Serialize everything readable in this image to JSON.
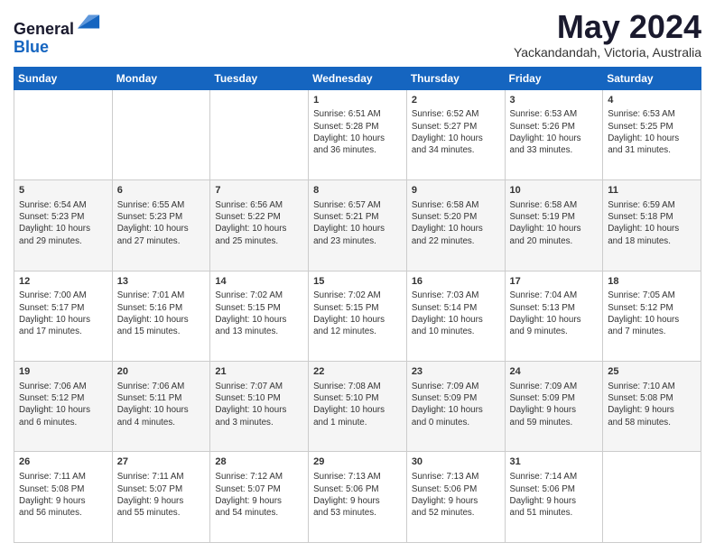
{
  "header": {
    "logo_line1": "General",
    "logo_line2": "Blue",
    "month": "May 2024",
    "location": "Yackandandah, Victoria, Australia"
  },
  "weekdays": [
    "Sunday",
    "Monday",
    "Tuesday",
    "Wednesday",
    "Thursday",
    "Friday",
    "Saturday"
  ],
  "weeks": [
    [
      {
        "day": "",
        "info": ""
      },
      {
        "day": "",
        "info": ""
      },
      {
        "day": "",
        "info": ""
      },
      {
        "day": "1",
        "info": "Sunrise: 6:51 AM\nSunset: 5:28 PM\nDaylight: 10 hours\nand 36 minutes."
      },
      {
        "day": "2",
        "info": "Sunrise: 6:52 AM\nSunset: 5:27 PM\nDaylight: 10 hours\nand 34 minutes."
      },
      {
        "day": "3",
        "info": "Sunrise: 6:53 AM\nSunset: 5:26 PM\nDaylight: 10 hours\nand 33 minutes."
      },
      {
        "day": "4",
        "info": "Sunrise: 6:53 AM\nSunset: 5:25 PM\nDaylight: 10 hours\nand 31 minutes."
      }
    ],
    [
      {
        "day": "5",
        "info": "Sunrise: 6:54 AM\nSunset: 5:23 PM\nDaylight: 10 hours\nand 29 minutes."
      },
      {
        "day": "6",
        "info": "Sunrise: 6:55 AM\nSunset: 5:23 PM\nDaylight: 10 hours\nand 27 minutes."
      },
      {
        "day": "7",
        "info": "Sunrise: 6:56 AM\nSunset: 5:22 PM\nDaylight: 10 hours\nand 25 minutes."
      },
      {
        "day": "8",
        "info": "Sunrise: 6:57 AM\nSunset: 5:21 PM\nDaylight: 10 hours\nand 23 minutes."
      },
      {
        "day": "9",
        "info": "Sunrise: 6:58 AM\nSunset: 5:20 PM\nDaylight: 10 hours\nand 22 minutes."
      },
      {
        "day": "10",
        "info": "Sunrise: 6:58 AM\nSunset: 5:19 PM\nDaylight: 10 hours\nand 20 minutes."
      },
      {
        "day": "11",
        "info": "Sunrise: 6:59 AM\nSunset: 5:18 PM\nDaylight: 10 hours\nand 18 minutes."
      }
    ],
    [
      {
        "day": "12",
        "info": "Sunrise: 7:00 AM\nSunset: 5:17 PM\nDaylight: 10 hours\nand 17 minutes."
      },
      {
        "day": "13",
        "info": "Sunrise: 7:01 AM\nSunset: 5:16 PM\nDaylight: 10 hours\nand 15 minutes."
      },
      {
        "day": "14",
        "info": "Sunrise: 7:02 AM\nSunset: 5:15 PM\nDaylight: 10 hours\nand 13 minutes."
      },
      {
        "day": "15",
        "info": "Sunrise: 7:02 AM\nSunset: 5:15 PM\nDaylight: 10 hours\nand 12 minutes."
      },
      {
        "day": "16",
        "info": "Sunrise: 7:03 AM\nSunset: 5:14 PM\nDaylight: 10 hours\nand 10 minutes."
      },
      {
        "day": "17",
        "info": "Sunrise: 7:04 AM\nSunset: 5:13 PM\nDaylight: 10 hours\nand 9 minutes."
      },
      {
        "day": "18",
        "info": "Sunrise: 7:05 AM\nSunset: 5:12 PM\nDaylight: 10 hours\nand 7 minutes."
      }
    ],
    [
      {
        "day": "19",
        "info": "Sunrise: 7:06 AM\nSunset: 5:12 PM\nDaylight: 10 hours\nand 6 minutes."
      },
      {
        "day": "20",
        "info": "Sunrise: 7:06 AM\nSunset: 5:11 PM\nDaylight: 10 hours\nand 4 minutes."
      },
      {
        "day": "21",
        "info": "Sunrise: 7:07 AM\nSunset: 5:10 PM\nDaylight: 10 hours\nand 3 minutes."
      },
      {
        "day": "22",
        "info": "Sunrise: 7:08 AM\nSunset: 5:10 PM\nDaylight: 10 hours\nand 1 minute."
      },
      {
        "day": "23",
        "info": "Sunrise: 7:09 AM\nSunset: 5:09 PM\nDaylight: 10 hours\nand 0 minutes."
      },
      {
        "day": "24",
        "info": "Sunrise: 7:09 AM\nSunset: 5:09 PM\nDaylight: 9 hours\nand 59 minutes."
      },
      {
        "day": "25",
        "info": "Sunrise: 7:10 AM\nSunset: 5:08 PM\nDaylight: 9 hours\nand 58 minutes."
      }
    ],
    [
      {
        "day": "26",
        "info": "Sunrise: 7:11 AM\nSunset: 5:08 PM\nDaylight: 9 hours\nand 56 minutes."
      },
      {
        "day": "27",
        "info": "Sunrise: 7:11 AM\nSunset: 5:07 PM\nDaylight: 9 hours\nand 55 minutes."
      },
      {
        "day": "28",
        "info": "Sunrise: 7:12 AM\nSunset: 5:07 PM\nDaylight: 9 hours\nand 54 minutes."
      },
      {
        "day": "29",
        "info": "Sunrise: 7:13 AM\nSunset: 5:06 PM\nDaylight: 9 hours\nand 53 minutes."
      },
      {
        "day": "30",
        "info": "Sunrise: 7:13 AM\nSunset: 5:06 PM\nDaylight: 9 hours\nand 52 minutes."
      },
      {
        "day": "31",
        "info": "Sunrise: 7:14 AM\nSunset: 5:06 PM\nDaylight: 9 hours\nand 51 minutes."
      },
      {
        "day": "",
        "info": ""
      }
    ]
  ]
}
